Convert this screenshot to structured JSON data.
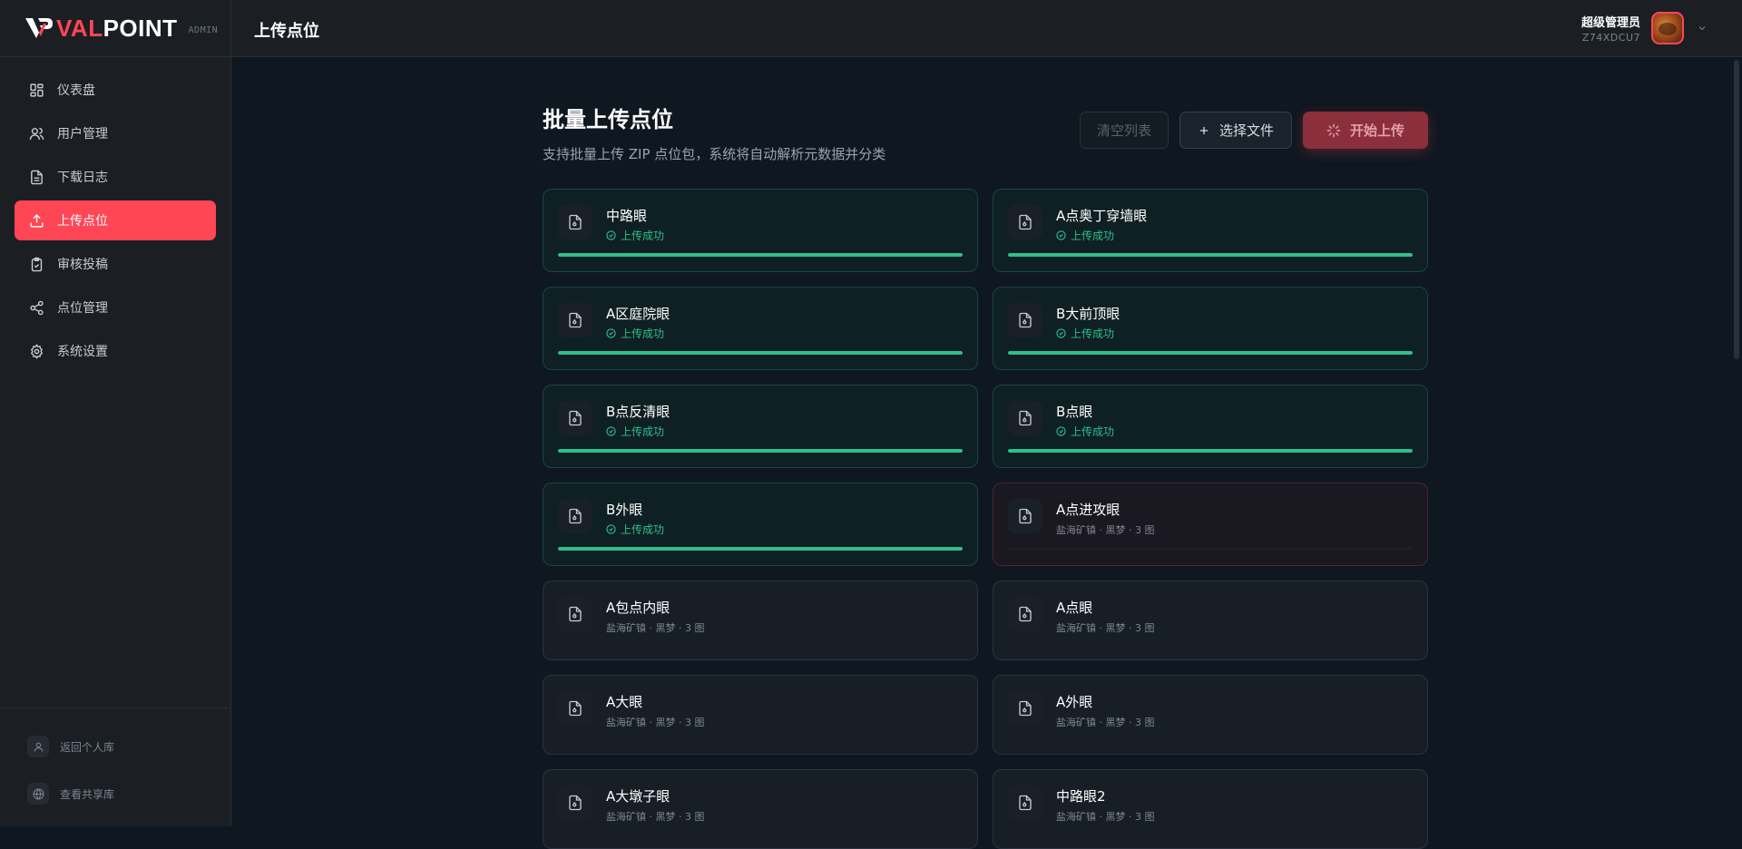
{
  "brand": {
    "logo_text_a": "VAL",
    "logo_text_b": "POINT",
    "admin_tag": "ADMIN"
  },
  "sidebar": {
    "items": [
      {
        "label": "仪表盘",
        "icon": "dashboard-icon"
      },
      {
        "label": "用户管理",
        "icon": "users-icon"
      },
      {
        "label": "下载日志",
        "icon": "file-text-icon"
      },
      {
        "label": "上传点位",
        "icon": "upload-icon",
        "active": true
      },
      {
        "label": "审核投稿",
        "icon": "clipboard-check-icon"
      },
      {
        "label": "点位管理",
        "icon": "share-icon"
      },
      {
        "label": "系统设置",
        "icon": "gear-icon"
      }
    ],
    "footer": {
      "personal": "返回个人库",
      "shared": "查看共享库"
    }
  },
  "topbar": {
    "title": "上传点位",
    "user_name": "超级管理员",
    "user_id": "Z74XDCU7"
  },
  "main": {
    "title": "批量上传点位",
    "subtitle": "支持批量上传 ZIP 点位包，系统将自动解析元数据并分类",
    "buttons": {
      "clear": "清空列表",
      "select": "选择文件",
      "start": "开始上传"
    }
  },
  "uploads": [
    {
      "name": "中路眼",
      "status": "success",
      "status_text": "上传成功",
      "progress": 1.0
    },
    {
      "name": "A点奥丁穿墙眼",
      "status": "success",
      "status_text": "上传成功",
      "progress": 1.0
    },
    {
      "name": "A区庭院眼",
      "status": "success",
      "status_text": "上传成功",
      "progress": 1.0
    },
    {
      "name": "B大前顶眼",
      "status": "success",
      "status_text": "上传成功",
      "progress": 1.0
    },
    {
      "name": "B点反清眼",
      "status": "success",
      "status_text": "上传成功",
      "progress": 1.0
    },
    {
      "name": "B点眼",
      "status": "success",
      "status_text": "上传成功",
      "progress": 1.0
    },
    {
      "name": "B外眼",
      "status": "success",
      "status_text": "上传成功",
      "progress": 1.0
    },
    {
      "name": "A点进攻眼",
      "status": "error",
      "meta": "盐海矿镇 · 黑梦 · 3 图",
      "progress": 0
    },
    {
      "name": "A包点内眼",
      "status": "pending",
      "meta": "盐海矿镇 · 黑梦 · 3 图"
    },
    {
      "name": "A点眼",
      "status": "pending",
      "meta": "盐海矿镇 · 黑梦 · 3 图"
    },
    {
      "name": "A大眼",
      "status": "pending",
      "meta": "盐海矿镇 · 黑梦 · 3 图"
    },
    {
      "name": "A外眼",
      "status": "pending",
      "meta": "盐海矿镇 · 黑梦 · 3 图"
    },
    {
      "name": "A大墩子眼",
      "status": "pending",
      "meta": "盐海矿镇 · 黑梦 · 3 图"
    },
    {
      "name": "中路眼2",
      "status": "pending",
      "meta": "盐海矿镇 · 黑梦 · 3 图"
    }
  ],
  "colors": {
    "accent": "#ff4655",
    "success": "#2fbf8a",
    "background": "#0f1720",
    "sidebar": "#1b1f24"
  }
}
